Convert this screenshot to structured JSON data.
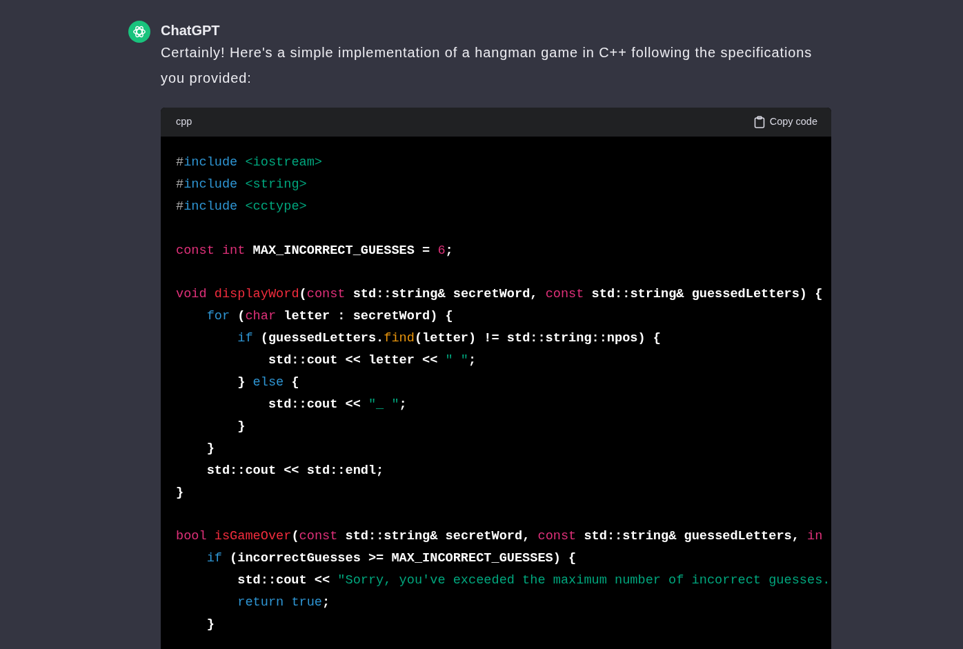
{
  "message": {
    "author": "ChatGPT",
    "text": "Certainly! Here's a simple implementation of a hangman game in C++ following the specifications you provided:"
  },
  "code_block": {
    "language": "cpp",
    "copy_label": "Copy code",
    "lines": [
      {
        "kind": "code",
        "tokens": [
          {
            "kind": "meta",
            "text": "#"
          },
          {
            "kind": "blue",
            "text": "include"
          },
          {
            "kind": "string",
            "text": " <iostream>"
          }
        ]
      },
      {
        "kind": "code",
        "tokens": [
          {
            "kind": "meta",
            "text": "#"
          },
          {
            "kind": "blue",
            "text": "include"
          },
          {
            "kind": "string",
            "text": " <string>"
          }
        ]
      },
      {
        "kind": "code",
        "tokens": [
          {
            "kind": "meta",
            "text": "#"
          },
          {
            "kind": "blue",
            "text": "include"
          },
          {
            "kind": "string",
            "text": " <cctype>"
          }
        ]
      },
      {
        "kind": "blank"
      },
      {
        "kind": "code",
        "tokens": [
          {
            "kind": "keyword",
            "text": "const"
          },
          {
            "kind": "keyword",
            "text": " int"
          },
          {
            "kind": "plain",
            "text": " MAX_INCORRECT_GUESSES = "
          },
          {
            "kind": "keyword",
            "text": "6"
          },
          {
            "kind": "plain",
            "text": ";"
          }
        ]
      },
      {
        "kind": "blank"
      },
      {
        "kind": "code",
        "tokens": [
          {
            "kind": "keyword",
            "text": "void"
          },
          {
            "kind": "func",
            "text": " displayWord"
          },
          {
            "kind": "plain",
            "text": "("
          },
          {
            "kind": "keyword",
            "text": "const"
          },
          {
            "kind": "plain",
            "text": " std::string& secretWord, "
          },
          {
            "kind": "keyword",
            "text": "const"
          },
          {
            "kind": "plain",
            "text": " std::string& guessedLetters) {"
          }
        ]
      },
      {
        "kind": "code",
        "tokens": [
          {
            "kind": "blue",
            "text": "    for"
          },
          {
            "kind": "plain",
            "text": " ("
          },
          {
            "kind": "keyword",
            "text": "char"
          },
          {
            "kind": "plain",
            "text": " letter : secretWord) {"
          }
        ]
      },
      {
        "kind": "code",
        "tokens": [
          {
            "kind": "blue",
            "text": "        if"
          },
          {
            "kind": "plain",
            "text": " (guessedLetters."
          },
          {
            "kind": "method",
            "text": "find"
          },
          {
            "kind": "plain",
            "text": "(letter) != std::string::npos) {"
          }
        ]
      },
      {
        "kind": "code",
        "tokens": [
          {
            "kind": "plain",
            "text": "            std::cout << letter << "
          },
          {
            "kind": "string",
            "text": "\" \""
          },
          {
            "kind": "plain",
            "text": ";"
          }
        ]
      },
      {
        "kind": "code",
        "tokens": [
          {
            "kind": "plain",
            "text": "        } "
          },
          {
            "kind": "blue",
            "text": "else"
          },
          {
            "kind": "plain",
            "text": " {"
          }
        ]
      },
      {
        "kind": "code",
        "tokens": [
          {
            "kind": "plain",
            "text": "            std::cout << "
          },
          {
            "kind": "string",
            "text": "\"_ \""
          },
          {
            "kind": "plain",
            "text": ";"
          }
        ]
      },
      {
        "kind": "code",
        "tokens": [
          {
            "kind": "plain",
            "text": "        }"
          }
        ]
      },
      {
        "kind": "code",
        "tokens": [
          {
            "kind": "plain",
            "text": "    }"
          }
        ]
      },
      {
        "kind": "code",
        "tokens": [
          {
            "kind": "plain",
            "text": "    std::cout << std::endl;"
          }
        ]
      },
      {
        "kind": "code",
        "tokens": [
          {
            "kind": "plain",
            "text": "}"
          }
        ]
      },
      {
        "kind": "blank"
      },
      {
        "kind": "code",
        "tokens": [
          {
            "kind": "keyword",
            "text": "bool"
          },
          {
            "kind": "func",
            "text": " isGameOver"
          },
          {
            "kind": "plain",
            "text": "("
          },
          {
            "kind": "keyword",
            "text": "const"
          },
          {
            "kind": "plain",
            "text": " std::string& secretWord, "
          },
          {
            "kind": "keyword",
            "text": "const"
          },
          {
            "kind": "plain",
            "text": " std::string& guessedLetters, "
          },
          {
            "kind": "keyword",
            "text": "in"
          }
        ]
      },
      {
        "kind": "code",
        "tokens": [
          {
            "kind": "blue",
            "text": "    if"
          },
          {
            "kind": "plain",
            "text": " (incorrectGuesses >= MAX_INCORRECT_GUESSES) {"
          }
        ]
      },
      {
        "kind": "code",
        "tokens": [
          {
            "kind": "plain",
            "text": "        std::cout << "
          },
          {
            "kind": "string",
            "text": "\"Sorry, you've exceeded the maximum number of incorrect guesses."
          }
        ]
      },
      {
        "kind": "code",
        "tokens": [
          {
            "kind": "blue",
            "text": "        return"
          },
          {
            "kind": "blue",
            "text": " true"
          },
          {
            "kind": "plain",
            "text": ";"
          }
        ]
      },
      {
        "kind": "code",
        "tokens": [
          {
            "kind": "plain",
            "text": "    }"
          }
        ]
      }
    ]
  }
}
